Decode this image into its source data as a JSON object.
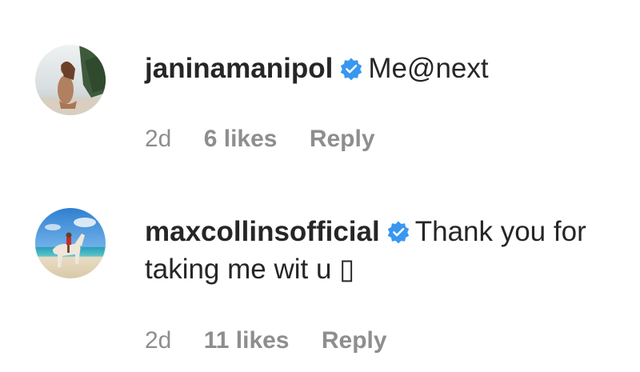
{
  "comments": [
    {
      "username": "janinamanipol",
      "verified": true,
      "text": "Me@next",
      "time": "2d",
      "likes": "6 likes",
      "reply_label": "Reply",
      "avatar_icon": "profile-photo-beach"
    },
    {
      "username": "maxcollinsofficial",
      "verified": true,
      "text": "Thank you for taking me wit u ▯",
      "time": "2d",
      "likes": "11 likes",
      "reply_label": "Reply",
      "avatar_icon": "profile-photo-horse-beach"
    }
  ],
  "colors": {
    "text_primary": "#262626",
    "text_secondary": "#8e8e8e",
    "verified_badge": "#3897f0"
  }
}
